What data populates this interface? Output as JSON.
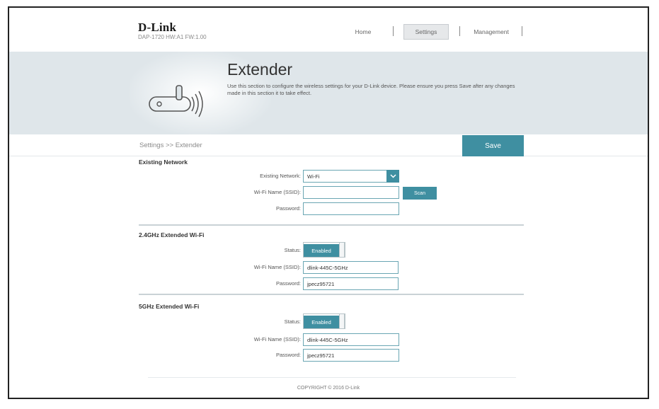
{
  "header": {
    "logo": "D-Link",
    "model_info": "DAP-1720 HW:A1 FW:1.00",
    "nav": {
      "home": "Home",
      "settings": "Settings",
      "management": "Management"
    }
  },
  "banner": {
    "title": "Extender",
    "description": "Use this section to configure the wireless settings for your D-Link device. Please ensure you press Save after any changes made in this section it to take effect."
  },
  "breadcrumb": "Settings >> Extender",
  "save_label": "Save",
  "existing_network": {
    "title": "Existing Network",
    "network_label": "Existing Network:",
    "network_value": "Wi-Fi",
    "ssid_label": "Wi-Fi Name (SSID):",
    "ssid_value": "",
    "scan_label": "Scan",
    "password_label": "Password:",
    "password_value": ""
  },
  "band_24": {
    "title": "2.4GHz Extended Wi-Fi",
    "status_label": "Status:",
    "status_value": "Enabled",
    "ssid_label": "Wi-Fi Name (SSID):",
    "ssid_value": "dlink-445C-5GHz",
    "password_label": "Password:",
    "password_value": "jpecz95721"
  },
  "band_5": {
    "title": "5GHz Extended Wi-Fi",
    "status_label": "Status:",
    "status_value": "Enabled",
    "ssid_label": "Wi-Fi Name (SSID):",
    "ssid_value": "dlink-445C-5GHz",
    "password_label": "Password:",
    "password_value": "jpecz95721"
  },
  "footer": "COPYRIGHT © 2016 D-Link",
  "colors": {
    "accent": "#3f8fa1",
    "banner": "#dfe6ea"
  }
}
